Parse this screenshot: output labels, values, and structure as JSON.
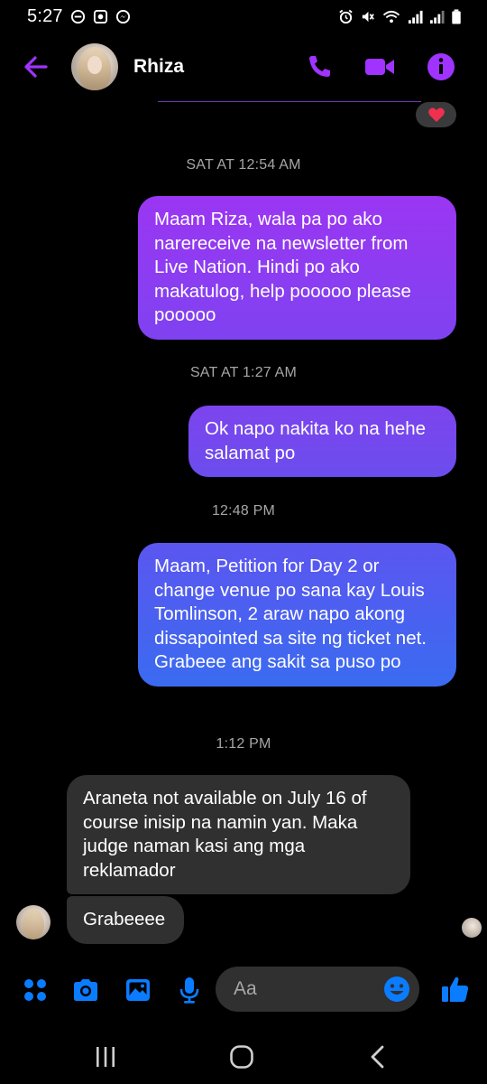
{
  "status_bar": {
    "time": "5:27",
    "icons": [
      "minus-circle-icon",
      "square-notification-icon",
      "messenger-icon",
      "alarm-icon",
      "mute-vibrate-icon",
      "wifi-icon",
      "signal-icon",
      "signal-icon-2",
      "battery-icon"
    ]
  },
  "header": {
    "contact_name": "Rhiza",
    "icons": [
      "back-arrow-icon",
      "phone-icon",
      "video-icon",
      "info-icon"
    ],
    "reaction": "heart-icon"
  },
  "conversation": {
    "timestamps": [
      "SAT AT 12:54 AM",
      "SAT AT 1:27 AM",
      "12:48 PM",
      "1:12 PM"
    ],
    "outgoing": [
      "Maam Riza, wala pa po ako narereceive na newsletter from Live Nation. Hindi po ako makatulog, help pooooo please pooooo",
      "Ok napo nakita ko na hehe salamat po",
      "Maam, Petition for Day 2 or change venue po sana kay Louis Tomlinson, 2 araw napo akong dissapointed sa site ng ticket net. Grabeee ang sakit sa puso po"
    ],
    "incoming": [
      "Araneta not available on July 16 of course inisip na namin yan. Maka judge naman kasi ang mga reklamador",
      "Grabeeee"
    ]
  },
  "composer": {
    "placeholder": "Aa",
    "value": "",
    "icons": [
      "menu-dots-icon",
      "camera-icon",
      "gallery-icon",
      "microphone-icon",
      "emoji-icon",
      "thumbs-up-icon"
    ]
  },
  "navigation": {
    "icons": [
      "recent-apps-icon",
      "home-icon",
      "back-icon"
    ]
  },
  "colors": {
    "accent_purple": "#a033ff",
    "accent_blue": "#0a7cff",
    "incoming_bubble": "#303030",
    "background": "#000000"
  }
}
